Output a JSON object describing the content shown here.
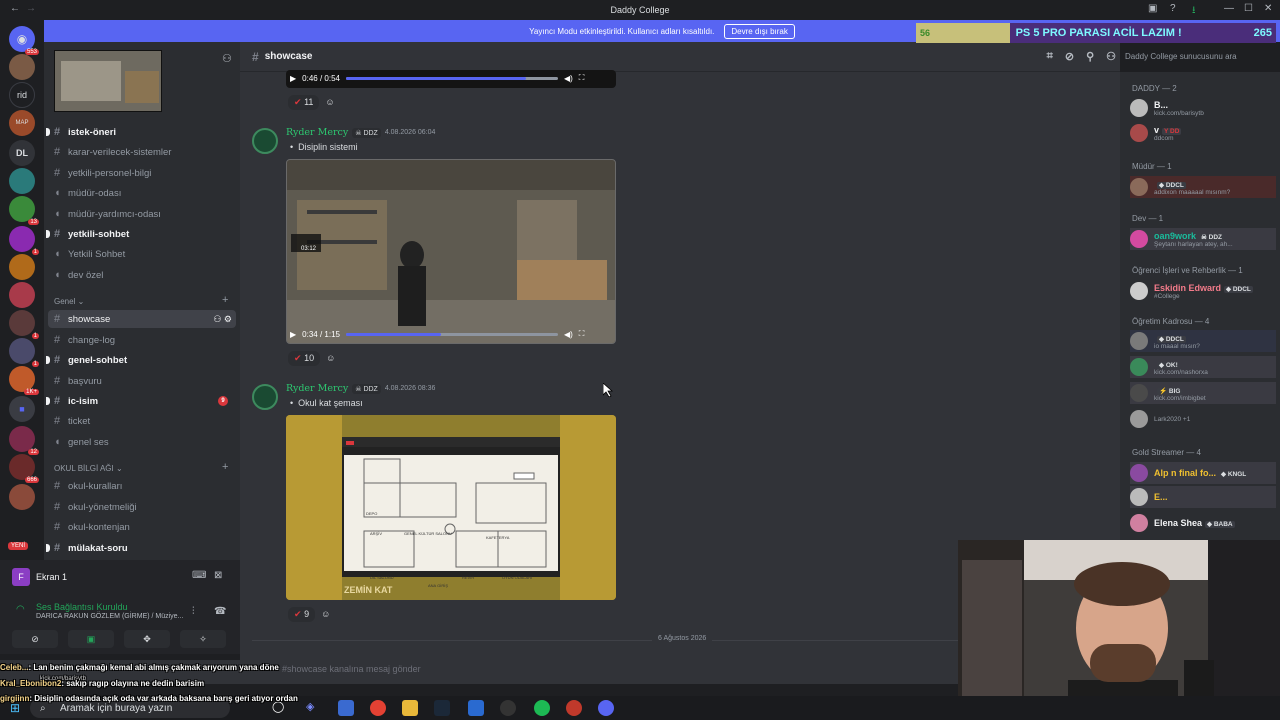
{
  "window": {
    "title": "Daddy College",
    "controls": [
      "—",
      "☐",
      "✕"
    ]
  },
  "banner": {
    "text": "Yayıncı Modu etkinleştirildi. Kullanıcı adları kısaltıldı.",
    "button": "Devre dışı bırak"
  },
  "overlay_goal": {
    "low_value": "56",
    "text": "PS 5 PRO PARASI ACİL LAZIM !",
    "value": "265",
    "progress": 0.26
  },
  "servers": [
    {
      "label": "",
      "badge": "553"
    },
    {
      "label": "",
      "badge": ""
    },
    {
      "label": "rid",
      "badge": ""
    },
    {
      "label": "MAP",
      "badge": ""
    },
    {
      "label": "DL",
      "badge": ""
    },
    {
      "label": "",
      "badge": ""
    },
    {
      "label": "",
      "badge": "13"
    },
    {
      "label": "",
      "badge": "1"
    },
    {
      "label": "",
      "badge": ""
    },
    {
      "label": "",
      "badge": ""
    },
    {
      "label": "",
      "badge": "1"
    },
    {
      "label": "",
      "badge": "1"
    },
    {
      "label": "",
      "badge": "1K+"
    },
    {
      "label": "",
      "badge": ""
    },
    {
      "label": "",
      "badge": "12"
    },
    {
      "label": "",
      "badge": "666"
    },
    {
      "label": "YENİ",
      "badge": ""
    }
  ],
  "channels": {
    "items": [
      {
        "name": "istek-öneri",
        "type": "text",
        "bold": true
      },
      {
        "name": "karar-verilecek-sistemler",
        "type": "text",
        "bold": false
      },
      {
        "name": "yetkili-personel-bilgi",
        "type": "text",
        "bold": false
      },
      {
        "name": "müdür-odası",
        "type": "voice",
        "bold": false
      },
      {
        "name": "müdür-yardımcı-odası",
        "type": "voice",
        "bold": false
      },
      {
        "name": "yetkili-sohbet",
        "type": "text",
        "bold": true
      },
      {
        "name": "Yetkili Sohbet",
        "type": "voice",
        "bold": false
      },
      {
        "name": "dev özel",
        "type": "voice",
        "bold": false
      }
    ],
    "category_genel": "Genel",
    "genel": [
      {
        "name": "showcase",
        "type": "text",
        "active": true
      },
      {
        "name": "change-log",
        "type": "text"
      },
      {
        "name": "genel-sohbet",
        "type": "text",
        "bold": true
      },
      {
        "name": "başvuru",
        "type": "text"
      },
      {
        "name": "ic-isim",
        "type": "text",
        "bold": true,
        "badge": "9"
      },
      {
        "name": "ticket",
        "type": "text"
      },
      {
        "name": "genel ses",
        "type": "voice"
      }
    ],
    "category_okul": "OKUL BİLGİ AĞI",
    "okul": [
      {
        "name": "okul-kuralları",
        "type": "text"
      },
      {
        "name": "okul-yönetmeliği",
        "type": "text"
      },
      {
        "name": "okul-kontenjan",
        "type": "text"
      },
      {
        "name": "mülakat-soru",
        "type": "text",
        "bold": true
      }
    ]
  },
  "voice_panel": {
    "screen": "Ekran 1",
    "connected": "Ses Bağlantısı Kuruldu",
    "subtitle": "DARICA RAKUN GÖZLEM (GİRME) / Müziye..."
  },
  "header": {
    "channel": "showcase",
    "search_placeholder": "Daddy College sunucusunu ara"
  },
  "messages": [
    {
      "video": {
        "time": "0:46 / 0:54",
        "progress": 0.85
      },
      "reaction_count": "11"
    },
    {
      "author": "Ryder Mercy",
      "tag": "DDZ",
      "timestamp": "4.08.2026 06:04",
      "text": "Disiplin sistemi",
      "video": {
        "time": "0:34 / 1:15",
        "progress": 0.45,
        "overlay_time": "03:12"
      },
      "reaction_count": "10"
    },
    {
      "author": "Ryder Mercy",
      "tag": "DDZ",
      "timestamp": "4.08.2026 08:36",
      "text": "Okul kat şeması",
      "image_caption": "ZEMİN KAT",
      "rooms": [
        "DEPO",
        "ARŞİV",
        "GENEL KÜLTÜR SALONU",
        "KAFETERYA",
        "DİL SALONU",
        "REVİR",
        "OYUN ODALARI",
        "ANA GİRİŞ"
      ],
      "reaction_count": "9"
    }
  ],
  "date_separator": "6 Ağustos 2026",
  "composer": {
    "placeholder": "#showcase kanalına mesaj gönder"
  },
  "members": {
    "groups": [
      {
        "title": "DADDY — 2",
        "members": [
          {
            "name": "B...",
            "sub": "kick.com/barisytb",
            "tag": ""
          },
          {
            "name": "v",
            "sub": "ddcom",
            "tag": "DD"
          }
        ]
      },
      {
        "title": "Müdür — 1",
        "members": [
          {
            "name": "",
            "sub": "addixon maaaaal mısınm?",
            "tag": "DDCL"
          }
        ]
      },
      {
        "title": "Dev — 1",
        "members": [
          {
            "name": "oan9work",
            "sub": "Şeytanı harlayan atey, ah...",
            "tag": "DDZ"
          }
        ]
      },
      {
        "title": "Öğrenci İşleri ve Rehberlik — 1",
        "members": [
          {
            "name": "Eskidin Edward",
            "sub": "#College",
            "tag": "DDCL"
          }
        ]
      },
      {
        "title": "Öğretim Kadrosu — 4",
        "members": [
          {
            "name": "",
            "sub": "io maaal mısın?",
            "tag": "DDCL"
          },
          {
            "name": "",
            "sub": "kick.com/nashorxa",
            "tag": "OK!"
          },
          {
            "name": "",
            "sub": "kick.com/imbigbet",
            "tag": "BIG"
          },
          {
            "name": "",
            "sub": "Lark2020 +1",
            "tag": ""
          }
        ]
      },
      {
        "title": "Gold Streamer — 4",
        "members": [
          {
            "name": "Alp n final fo...",
            "sub": "",
            "tag": "KNGL"
          },
          {
            "name": "E...",
            "sub": "",
            "tag": ""
          },
          {
            "name": "Elena Shea",
            "sub": "",
            "tag": "BABA"
          }
        ]
      }
    ]
  },
  "chat_overlay": [
    {
      "user": "Celeb...",
      "text": "Lan benim çakmağı kemal abi almış çakmak arıyorum yana döne",
      "sub": "kick.com/barisytb"
    },
    {
      "user": "Kral_Ebonibon2",
      "text": ": sakıp ragıp olayına ne dedin barisim",
      "sub": ""
    },
    {
      "user": "girgiinn",
      "text": ": Disiplin odasında açık oda var arkada baksana barış geri atıyor ordan",
      "sub": ""
    }
  ],
  "taskbar": {
    "search": "Aramak için buraya yazın"
  },
  "colors": {
    "accent": "#5865f2",
    "author": "#2dc770",
    "background": "#313338",
    "sidebar": "#2b2d31"
  }
}
